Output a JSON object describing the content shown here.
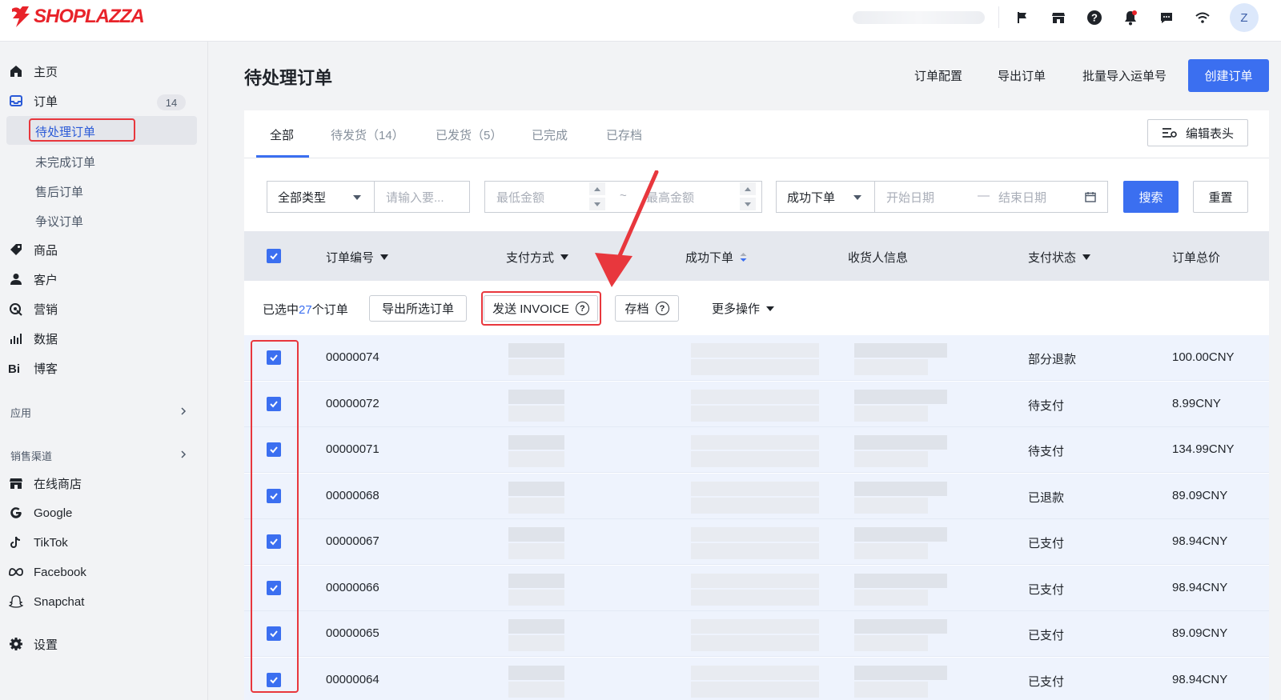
{
  "brand": {
    "name": "SHOPLAZZA",
    "color": "#e8232a"
  },
  "topbar": {
    "icons": [
      "flag-icon",
      "store-icon",
      "help-icon",
      "bell-icon",
      "message-icon",
      "wifi-icon"
    ],
    "avatar_initial": "Z"
  },
  "sidebar": {
    "items": [
      {
        "label": "主页",
        "icon": "home-icon"
      },
      {
        "label": "订单",
        "icon": "order-icon",
        "badge": "14"
      },
      {
        "label": "商品",
        "icon": "tag-icon"
      },
      {
        "label": "客户",
        "icon": "user-icon"
      },
      {
        "label": "营销",
        "icon": "marketing-icon"
      },
      {
        "label": "数据",
        "icon": "chart-icon"
      },
      {
        "label": "博客",
        "icon": "blog-icon"
      }
    ],
    "order_subitems": [
      "待处理订单",
      "未完成订单",
      "售后订单",
      "争议订单"
    ],
    "apps_label": "应用",
    "channels_label": "销售渠道",
    "channels": [
      {
        "label": "在线商店",
        "icon": "store-icon"
      },
      {
        "label": "Google",
        "icon": "google-icon"
      },
      {
        "label": "TikTok",
        "icon": "tiktok-icon"
      },
      {
        "label": "Facebook",
        "icon": "meta-icon"
      },
      {
        "label": "Snapchat",
        "icon": "snapchat-icon"
      }
    ],
    "settings_label": "设置"
  },
  "header": {
    "title": "待处理订单",
    "actions": [
      "订单配置",
      "导出订单",
      "批量导入运单号"
    ],
    "create_label": "创建订单"
  },
  "tabs": [
    "全部",
    "待发货（14）",
    "已发货（5）",
    "已完成",
    "已存档"
  ],
  "edit_header_label": "编辑表头",
  "filters": {
    "type_value": "全部类型",
    "keyword_placeholder": "请输入要...",
    "min_amount_placeholder": "最低金额",
    "range_sep": "~",
    "max_amount_placeholder": "最高金额",
    "date_type_value": "成功下单",
    "start_date_placeholder": "开始日期",
    "date_sep": "—",
    "end_date_placeholder": "结束日期",
    "search_label": "搜索",
    "reset_label": "重置"
  },
  "table": {
    "columns": [
      "订单编号",
      "支付方式",
      "成功下单",
      "收货人信息",
      "支付状态",
      "订单总价"
    ],
    "bulk": {
      "prefix": "已选中",
      "count": "27",
      "suffix": "个订单",
      "export_label": "导出所选订单",
      "invoice_label": "发送 INVOICE",
      "archive_label": "存档",
      "more_label": "更多操作"
    },
    "rows": [
      {
        "id": "00000074",
        "status": "部分退款",
        "total": "100.00CNY"
      },
      {
        "id": "00000072",
        "status": "待支付",
        "total": "8.99CNY"
      },
      {
        "id": "00000071",
        "status": "待支付",
        "total": "134.99CNY"
      },
      {
        "id": "00000068",
        "status": "已退款",
        "total": "89.09CNY"
      },
      {
        "id": "00000067",
        "status": "已支付",
        "total": "98.94CNY"
      },
      {
        "id": "00000066",
        "status": "已支付",
        "total": "98.94CNY"
      },
      {
        "id": "00000065",
        "status": "已支付",
        "total": "89.09CNY"
      },
      {
        "id": "00000064",
        "status": "已支付",
        "total": "98.94CNY"
      }
    ]
  },
  "colors": {
    "accent": "#3b6ff0",
    "highlight": "#e8373d"
  }
}
